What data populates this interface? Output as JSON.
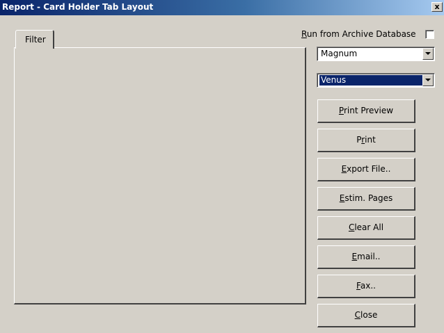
{
  "window": {
    "title": "Report  - Card Holder Tab Layout",
    "close_label": "x"
  },
  "tabs": [
    {
      "label": "Filter"
    }
  ],
  "archive": {
    "label_mnemonic": "R",
    "label_rest": "un from Archive Database",
    "checked": false
  },
  "combos": {
    "first": {
      "value": "Magnum"
    },
    "second": {
      "value": "Venus",
      "selected": true
    }
  },
  "buttons": {
    "print_preview": {
      "pre": "",
      "mn": "P",
      "post": "rint Preview"
    },
    "print": {
      "pre": "P",
      "mn": "r",
      "post": "int"
    },
    "export_file": {
      "pre": "",
      "mn": "E",
      "post": "xport File.."
    },
    "estim_pages": {
      "pre": "",
      "mn": "E",
      "post": "stim. Pages"
    },
    "clear_all": {
      "pre": "",
      "mn": "C",
      "post": "lear All"
    },
    "email": {
      "pre": "",
      "mn": "E",
      "post": "mail.."
    },
    "fax": {
      "pre": "",
      "mn": "F",
      "post": "ax.."
    },
    "close": {
      "pre": "",
      "mn": "C",
      "post": "lose"
    }
  }
}
